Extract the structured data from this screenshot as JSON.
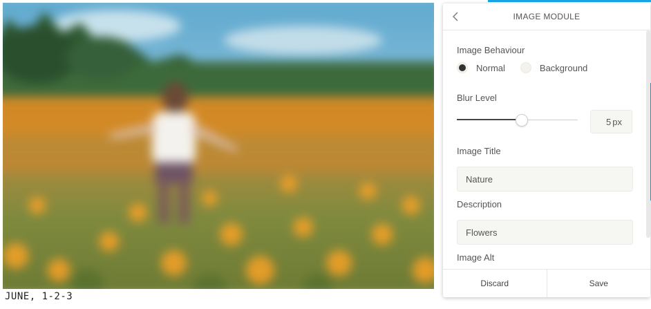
{
  "photo": {
    "description_icon": "blurred-landscape-photo"
  },
  "caption": "JUNE, 1-2-3",
  "panel": {
    "title": "IMAGE MODULE",
    "back_icon": "chevron-left-icon",
    "image_behaviour": {
      "label": "Image Behaviour",
      "options": [
        {
          "label": "Normal",
          "selected": true
        },
        {
          "label": "Background",
          "selected": false
        }
      ]
    },
    "blur_level": {
      "label": "Blur Level",
      "value": "5",
      "unit": "px",
      "slider_fraction": 0.53
    },
    "image_title": {
      "label": "Image Title",
      "value": "Nature"
    },
    "description": {
      "label": "Description",
      "value": "Flowers"
    },
    "image_alt": {
      "label": "Image Alt"
    },
    "footer": {
      "discard": "Discard",
      "save": "Save"
    }
  },
  "colors": {
    "accent": "#16a6e8",
    "field_bg": "#f6f6f2",
    "slider_fill": "#444444"
  }
}
